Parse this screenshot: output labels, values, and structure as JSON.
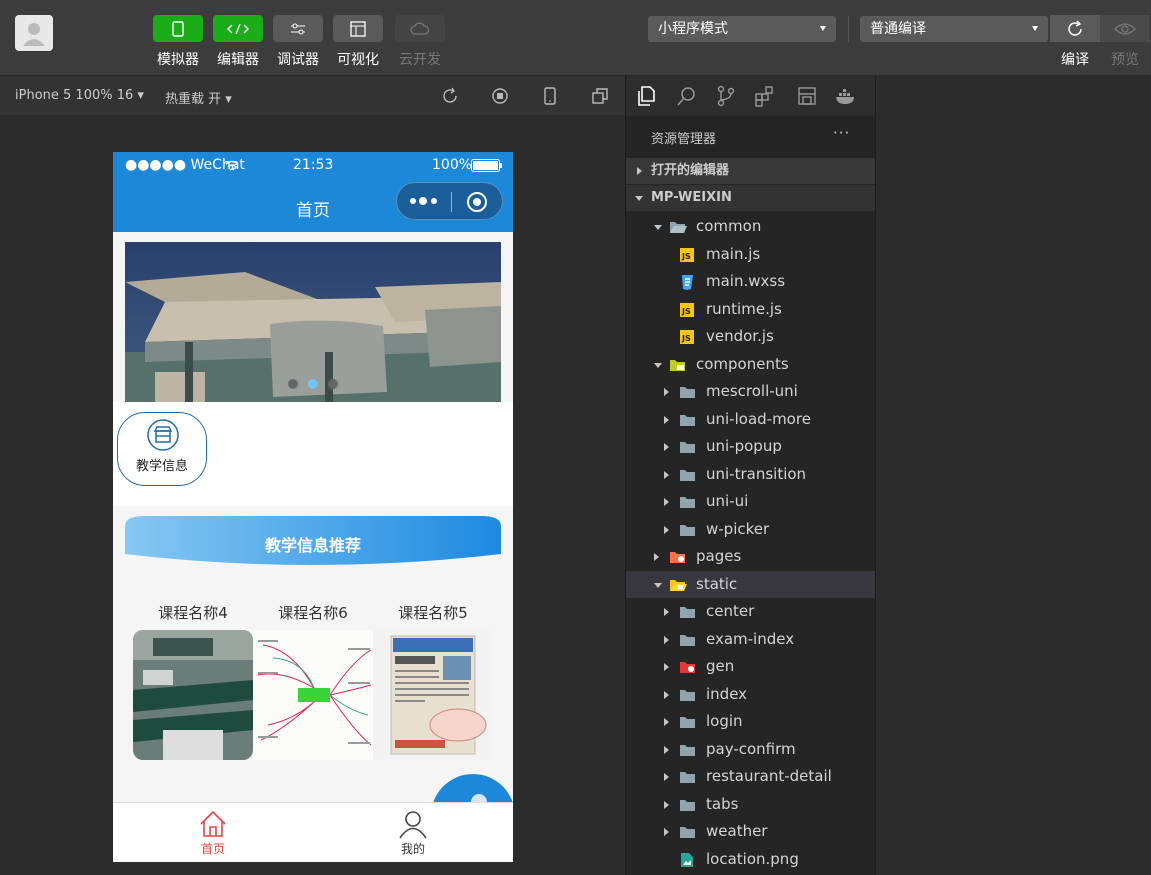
{
  "toolbar": {
    "tools": [
      {
        "label": "模拟器"
      },
      {
        "label": "编辑器"
      },
      {
        "label": "调试器"
      },
      {
        "label": "可视化"
      },
      {
        "label": "云开发"
      }
    ],
    "mode_select": "小程序模式",
    "compile_select": "普通编译",
    "compile_label": "编译",
    "preview_label": "预览"
  },
  "simulator_bar": {
    "device": "iPhone 5 100% 16",
    "hot_reload": "热重载 开"
  },
  "phone": {
    "status": {
      "carrier": "●●●●● WeChat",
      "time": "21:53",
      "battery": "100%"
    },
    "nav_title": "首页",
    "icon_label": "教学信息",
    "recommend_title": "教学信息推荐",
    "courses": [
      {
        "name": "课程名称4"
      },
      {
        "name": "课程名称6"
      },
      {
        "name": "课程名称5"
      }
    ],
    "tabs": [
      {
        "label": "首页",
        "color": "#e64340"
      },
      {
        "label": "我的",
        "color": "#333333"
      }
    ]
  },
  "explorer": {
    "title": "资源管理器",
    "more": "···",
    "open_editors": "打开的编辑器",
    "project": "MP-WEIXIN",
    "tree": [
      {
        "name": "common",
        "type": "folder-open",
        "indent": 1,
        "arrow": "down"
      },
      {
        "name": "main.js",
        "type": "js",
        "indent": 2,
        "arrow": "none"
      },
      {
        "name": "main.wxss",
        "type": "css",
        "indent": 2,
        "arrow": "none"
      },
      {
        "name": "runtime.js",
        "type": "js",
        "indent": 2,
        "arrow": "none"
      },
      {
        "name": "vendor.js",
        "type": "js",
        "indent": 2,
        "arrow": "none"
      },
      {
        "name": "components",
        "type": "folder-comp",
        "indent": 1,
        "arrow": "down"
      },
      {
        "name": "mescroll-uni",
        "type": "folder",
        "indent": 2,
        "arrow": "right"
      },
      {
        "name": "uni-load-more",
        "type": "folder",
        "indent": 2,
        "arrow": "right"
      },
      {
        "name": "uni-popup",
        "type": "folder",
        "indent": 2,
        "arrow": "right"
      },
      {
        "name": "uni-transition",
        "type": "folder",
        "indent": 2,
        "arrow": "right"
      },
      {
        "name": "uni-ui",
        "type": "folder",
        "indent": 2,
        "arrow": "right"
      },
      {
        "name": "w-picker",
        "type": "folder",
        "indent": 2,
        "arrow": "right"
      },
      {
        "name": "pages",
        "type": "folder-pages",
        "indent": 1,
        "arrow": "right"
      },
      {
        "name": "static",
        "type": "folder-static",
        "indent": 1,
        "arrow": "down",
        "selected": true
      },
      {
        "name": "center",
        "type": "folder",
        "indent": 2,
        "arrow": "right"
      },
      {
        "name": "exam-index",
        "type": "folder",
        "indent": 2,
        "arrow": "right"
      },
      {
        "name": "gen",
        "type": "folder-gen",
        "indent": 2,
        "arrow": "right"
      },
      {
        "name": "index",
        "type": "folder",
        "indent": 2,
        "arrow": "right"
      },
      {
        "name": "login",
        "type": "folder",
        "indent": 2,
        "arrow": "right"
      },
      {
        "name": "pay-confirm",
        "type": "folder",
        "indent": 2,
        "arrow": "right"
      },
      {
        "name": "restaurant-detail",
        "type": "folder",
        "indent": 2,
        "arrow": "right"
      },
      {
        "name": "tabs",
        "type": "folder",
        "indent": 2,
        "arrow": "right"
      },
      {
        "name": "weather",
        "type": "folder",
        "indent": 2,
        "arrow": "right"
      },
      {
        "name": "location.png",
        "type": "png",
        "indent": 2,
        "arrow": "none"
      }
    ]
  }
}
